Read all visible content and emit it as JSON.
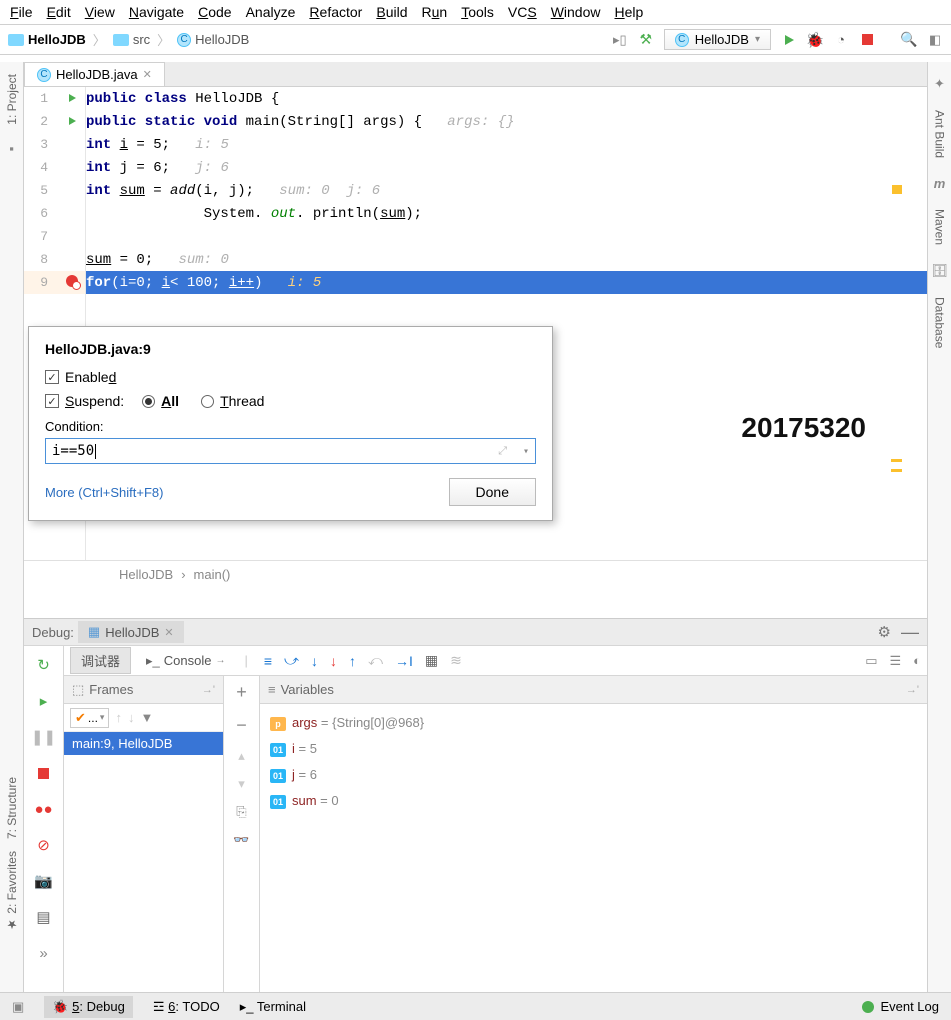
{
  "menu": {
    "file": "File",
    "edit": "Edit",
    "view": "View",
    "navigate": "Navigate",
    "code": "Code",
    "analyze": "Analyze",
    "refactor": "Refactor",
    "build": "Build",
    "run": "Run",
    "tools": "Tools",
    "vcs": "VCS",
    "window": "Window",
    "help": "Help"
  },
  "crumb": {
    "project": "HelloJDB",
    "folder": "src",
    "class": "HelloJDB"
  },
  "runConfig": {
    "name": "HelloJDB"
  },
  "tab": {
    "file": "HelloJDB.java"
  },
  "sidebars": {
    "project": "1: Project",
    "structure": "7: Structure",
    "favorites": "2: Favorites",
    "ant": "Ant Build",
    "maven": "Maven",
    "database": "Database"
  },
  "code": {
    "l1": {
      "pre": "public class ",
      "name": "HelloJDB",
      "post": " {"
    },
    "l2": {
      "pre": "    public static void ",
      "name": "main",
      "args": "(String[] args)",
      "post": " {",
      "hint": "   args: {}"
    },
    "l3": {
      "pre": "        int ",
      "var": "i",
      "post": " = 5;",
      "hint": "   i: 5"
    },
    "l4": {
      "pre": "              int ",
      "var": "j",
      "post": " = 6;",
      "hint": "   j: 6"
    },
    "l5": {
      "pre": "           int ",
      "var": "sum",
      "post": " = ",
      "call": "add",
      "args": "(i, j);",
      "hint": "   sum: 0  j: 6"
    },
    "l6": {
      "pre": "            System.",
      "out": " out",
      "post": ". println(",
      "arg": "sum",
      "end": ");"
    },
    "l8": {
      "pre": "           ",
      "var": "sum",
      "post": " = 0;",
      "hint": "   sum: 0"
    },
    "l9": {
      "pre": "              for",
      "body": "(i=0; i< 100; i++)",
      "hint": "   i: 5"
    }
  },
  "breadcrumb2": {
    "a": "HelloJDB",
    "b": "main()"
  },
  "watermark": "20175320",
  "popup": {
    "title": "HelloJDB.java:9",
    "enabled": "Enabled",
    "suspend": "Suspend:",
    "all": "All",
    "thread": "Thread",
    "condition": "Condition:",
    "condValue": "i==50",
    "more": "More (Ctrl+Shift+F8)",
    "done": "Done"
  },
  "debug": {
    "label": "Debug:",
    "tab": "HelloJDB",
    "subtabs": {
      "debugger": "调试器",
      "console": "Console"
    },
    "frames": {
      "hdr": "Frames",
      "row": "main:9, HelloJDB",
      "sel": "..."
    },
    "vars": {
      "hdr": "Variables",
      "items": [
        {
          "badge": "p",
          "name": "args",
          "val": " = {String[0]@968}"
        },
        {
          "badge": "01",
          "name": "i",
          "val": " = 5"
        },
        {
          "badge": "01",
          "name": "j",
          "val": " = 6"
        },
        {
          "badge": "01",
          "name": "sum",
          "val": " = 0"
        }
      ]
    }
  },
  "status": {
    "debug": "5: Debug",
    "todo": "6: TODO",
    "terminal": "Terminal",
    "eventlog": "Event Log"
  }
}
